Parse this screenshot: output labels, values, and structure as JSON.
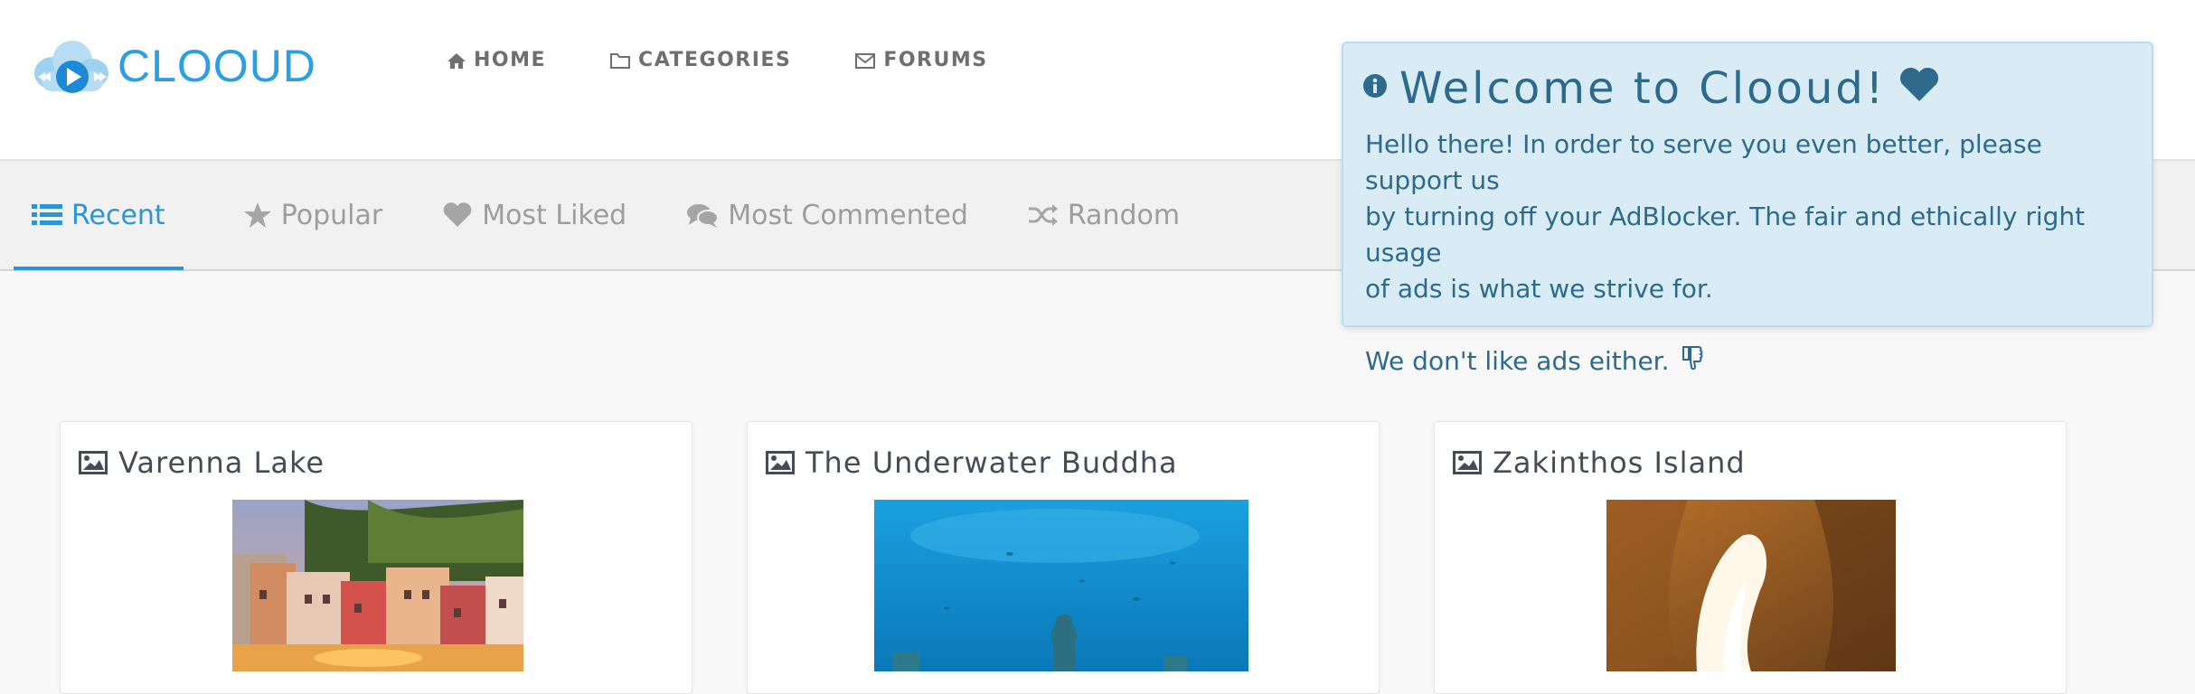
{
  "brand": {
    "name": "CLOOUD",
    "accent_color": "#2b9fe3"
  },
  "nav": {
    "items": [
      {
        "label": "HOME",
        "icon": "home-icon"
      },
      {
        "label": "CATEGORIES",
        "icon": "folder-icon"
      },
      {
        "label": "FORUMS",
        "icon": "envelope-icon"
      }
    ]
  },
  "tabs": {
    "active_color": "#2b95d6",
    "items": [
      {
        "label": "Recent",
        "icon": "list-icon",
        "active": true
      },
      {
        "label": "Popular",
        "icon": "star-icon",
        "active": false
      },
      {
        "label": "Most Liked",
        "icon": "heart-icon",
        "active": false
      },
      {
        "label": "Most Commented",
        "icon": "comments-icon",
        "active": false
      },
      {
        "label": "Random",
        "icon": "shuffle-icon",
        "active": false
      }
    ]
  },
  "cards": [
    {
      "title": "Varenna Lake",
      "icon": "image-icon",
      "thumb": "lakeside-village-photo"
    },
    {
      "title": "The Underwater Buddha",
      "icon": "image-icon",
      "thumb": "underwater-buddha-photo"
    },
    {
      "title": "Zakinthos Island",
      "icon": "image-icon",
      "thumb": "sea-cave-photo"
    }
  ],
  "alert": {
    "title": "Welcome to Clooud!",
    "title_icon": "info-icon",
    "title_trailing_icon": "heart-icon",
    "body_line1": "Hello there! In order to serve you even better, please support us",
    "body_line2": "by turning off your AdBlocker. The fair and ethically right usage",
    "body_line3": "of ads is what we strive for.",
    "body_line4": "We don't like ads either.",
    "body_trailing_icon": "thumbs-down-icon",
    "background_color": "#d9ecf6",
    "text_color": "#2d6a8c"
  }
}
